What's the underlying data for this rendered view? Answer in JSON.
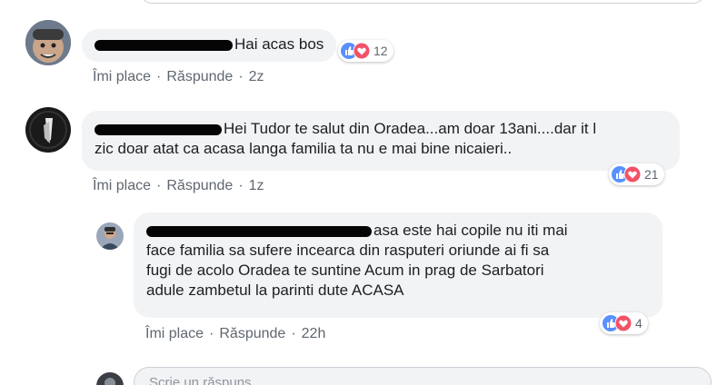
{
  "comments": [
    {
      "text": "Hai acas bos",
      "reaction_count": "12",
      "like_label": "Îmi place",
      "reply_label": "Răspunde",
      "time": "2z"
    },
    {
      "text_line1": "Hei Tudor te salut din Oradea...am doar 13ani....dar it l",
      "text_line2": "zic doar atat ca acasa langa familia ta nu e mai bine nicaieri..",
      "reaction_count": "21",
      "like_label": "Îmi place",
      "reply_label": "Răspunde",
      "time": "1z"
    }
  ],
  "reply": {
    "text_line1": "asa este hai copile nu iti mai",
    "text_line2": "face familia sa sufere incearca din rasputeri oriunde ai fi sa",
    "text_line3": "fugi de acolo Oradea te suntine Acum in prag de Sarbatori",
    "text_line4": "adule zambetul la parinti dute ACASA",
    "reaction_count": "4",
    "like_label": "Îmi place",
    "reply_label": "Răspunde",
    "time": "22h"
  },
  "input": {
    "placeholder": "Scrie un răspuns..."
  },
  "colors": {
    "like_blue": "#5890ff",
    "love_red": "#f25268",
    "bubble_bg": "#f2f3f5",
    "meta_gray": "#606770"
  },
  "icons": [
    "like-icon",
    "love-icon",
    "avatar"
  ]
}
